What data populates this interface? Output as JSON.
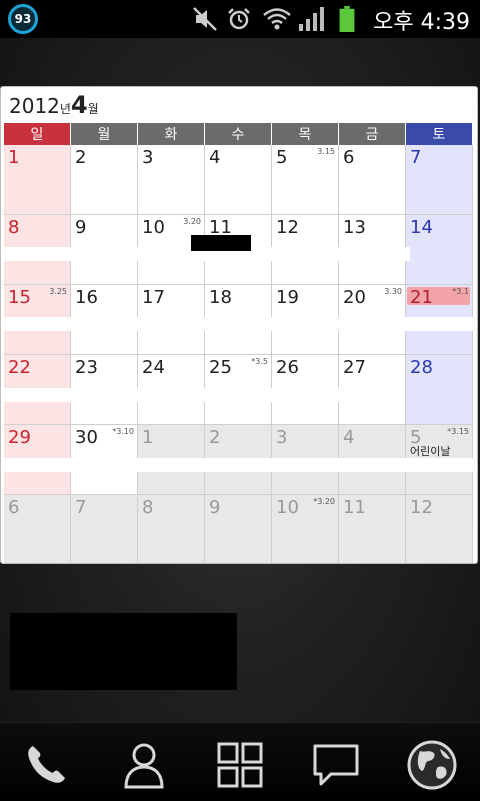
{
  "status_bar": {
    "battery_level": "93",
    "time": "오후 4:39",
    "icons": [
      "battery-ring-icon",
      "mute-icon",
      "alarm-icon",
      "wifi-icon",
      "signal-icon",
      "battery-icon"
    ]
  },
  "calendar": {
    "year": "2012",
    "year_suffix": "년",
    "month": "4",
    "month_suffix": "월",
    "weekdays": [
      "일",
      "월",
      "화",
      "수",
      "목",
      "금",
      "토"
    ],
    "weeks": [
      [
        {
          "day": "1",
          "type": "sun"
        },
        {
          "day": "2"
        },
        {
          "day": "3"
        },
        {
          "day": "4"
        },
        {
          "day": "5",
          "lunar": "3.15"
        },
        {
          "day": "6"
        },
        {
          "day": "7",
          "type": "sat"
        }
      ],
      [
        {
          "day": "8",
          "type": "sun"
        },
        {
          "day": "9"
        },
        {
          "day": "10",
          "lunar": "3.20"
        },
        {
          "day": "11"
        },
        {
          "day": "12"
        },
        {
          "day": "13"
        },
        {
          "day": "14",
          "type": "sat"
        }
      ],
      [
        {
          "day": "15",
          "type": "sun",
          "lunar": "3.25"
        },
        {
          "day": "16"
        },
        {
          "day": "17"
        },
        {
          "day": "18"
        },
        {
          "day": "19"
        },
        {
          "day": "20",
          "lunar": "3.30"
        },
        {
          "day": "21",
          "type": "sat",
          "lunar": "*3.1",
          "today": true
        }
      ],
      [
        {
          "day": "22",
          "type": "sun"
        },
        {
          "day": "23"
        },
        {
          "day": "24"
        },
        {
          "day": "25",
          "lunar": "*3.5"
        },
        {
          "day": "26"
        },
        {
          "day": "27"
        },
        {
          "day": "28",
          "type": "sat"
        }
      ],
      [
        {
          "day": "29",
          "type": "sun"
        },
        {
          "day": "30",
          "lunar": "*3.10"
        },
        {
          "day": "1",
          "type": "other"
        },
        {
          "day": "2",
          "type": "other"
        },
        {
          "day": "3",
          "type": "other"
        },
        {
          "day": "4",
          "type": "other"
        },
        {
          "day": "5",
          "type": "other",
          "lunar": "*3.15",
          "event": "어린이날"
        }
      ],
      [
        {
          "day": "6",
          "type": "other"
        },
        {
          "day": "7",
          "type": "other"
        },
        {
          "day": "8",
          "type": "other"
        },
        {
          "day": "9",
          "type": "other"
        },
        {
          "day": "10",
          "type": "other",
          "lunar": "*3.20"
        },
        {
          "day": "11",
          "type": "other"
        },
        {
          "day": "12",
          "type": "other"
        }
      ]
    ]
  },
  "dock": {
    "items": [
      "phone-icon",
      "contacts-icon",
      "apps-icon",
      "messaging-icon",
      "internet-icon"
    ]
  },
  "colors": {
    "sunday": "#c8232f",
    "saturday": "#2b38b5",
    "today_highlight": "#f3a4a8",
    "battery_ring": "#1fa4d8"
  }
}
